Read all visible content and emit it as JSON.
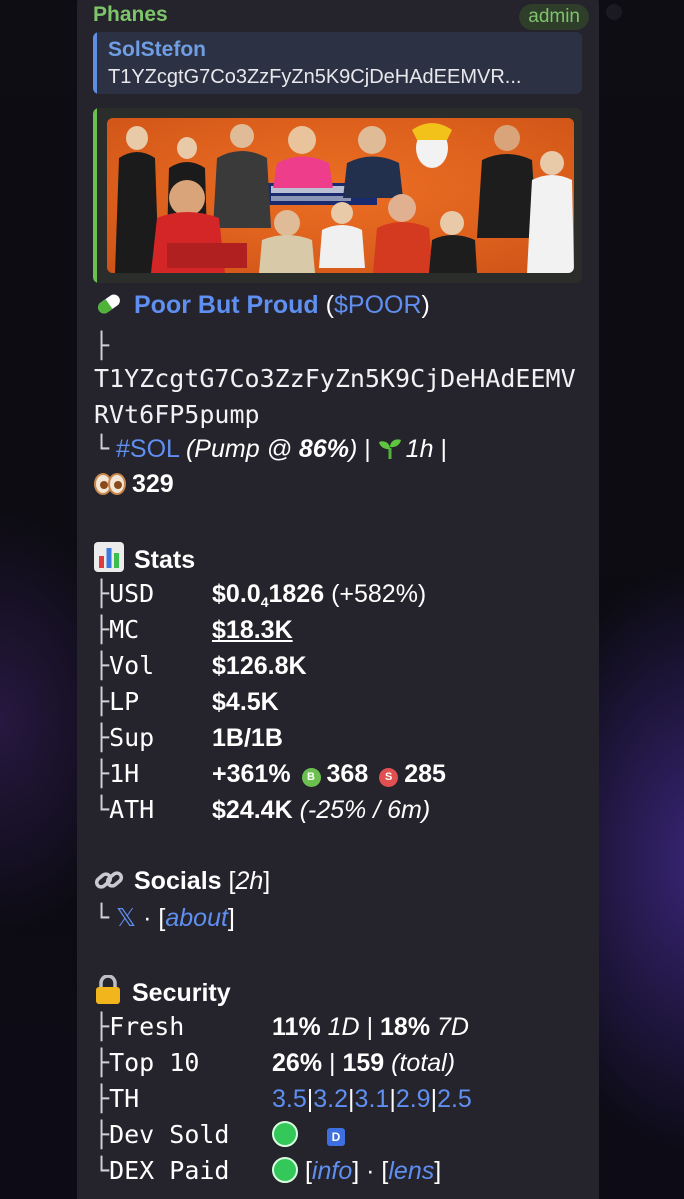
{
  "message": {
    "sender": "Phanes",
    "badge": "admin",
    "reply": {
      "name": "SolStefon",
      "text": "T1YZcgtG7Co3ZzFyZn5K9CjDeHAdEEMVR..."
    }
  },
  "token": {
    "name": "Poor But Proud",
    "paren_open": "(",
    "ticker": "$POOR",
    "paren_close": ")",
    "tree_branch": "├",
    "tree_end": "└",
    "address_line1": "T1YZcgtG7Co3ZzFyZn5K9CjDeHAdEEMV",
    "address_line2": "RVt6FP5pump",
    "chain": "#SOL",
    "pump_prefix": "(Pump @ ",
    "pump_pct": "86%",
    "pump_suffix": ")",
    "sep": "|",
    "age": "1h",
    "views": "329"
  },
  "stats": {
    "title": "Stats",
    "rows": {
      "usd": {
        "branch": "├",
        "label": "USD",
        "price_a": "$0.0",
        "price_sub": "4",
        "price_b": "1826",
        "change": "(+582%)"
      },
      "mc": {
        "branch": "├",
        "label": "MC",
        "value": "$18.3K"
      },
      "vol": {
        "branch": "├",
        "label": "Vol",
        "value": "$126.8K"
      },
      "lp": {
        "branch": "├",
        "label": "LP",
        "value": "$4.5K"
      },
      "sup": {
        "branch": "├",
        "label": "Sup",
        "value": "1B/1B"
      },
      "h1": {
        "branch": "├",
        "label": "1H",
        "value": "+361%",
        "buy_badge": "B",
        "buys": "368",
        "sell_badge": "S",
        "sells": "285"
      },
      "ath": {
        "branch": "└",
        "label": "ATH",
        "value": "$24.4K",
        "detail": "(-25% / 6m)"
      }
    }
  },
  "socials": {
    "title": "Socials",
    "age_open": "[",
    "age": "2h",
    "age_close": "]",
    "branch": "└",
    "x_icon": "𝕏",
    "dot": "·",
    "about_open": "[",
    "about": "about",
    "about_close": "]"
  },
  "security": {
    "title": "Security",
    "rows": {
      "fresh": {
        "branch": "├",
        "label": "Fresh",
        "v1": "11%",
        "p1": "1D",
        "sep": "|",
        "v2": "18%",
        "p2": "7D"
      },
      "top10": {
        "branch": "├",
        "label": "Top 10",
        "v1": "26%",
        "sep": "|",
        "v2": "159",
        "note": "(total)"
      },
      "th": {
        "branch": "├",
        "label": "TH",
        "values": [
          "3.5",
          "3.2",
          "3.1",
          "2.9",
          "2.5"
        ],
        "sep": "|"
      },
      "dev": {
        "branch": "├",
        "label": "Dev Sold",
        "badge": "D"
      },
      "dex": {
        "branch": "└",
        "label": "DEX Paid",
        "info_open": "[",
        "info": "info",
        "info_close": "]",
        "dot": "·",
        "lens_open": "[",
        "lens": "lens",
        "lens_close": "]"
      }
    }
  },
  "icons": {
    "pill": "pill-icon",
    "views": "eyes-icon",
    "seedling": "seedling-icon",
    "stats": "bar-chart-icon",
    "socials": "link-icon",
    "security": "lock-icon",
    "x": "x-logo-icon"
  },
  "colors": {
    "link": "#5f8ff0",
    "sender": "#7ec46a",
    "reply_accent": "#5d8ee0",
    "preview_accent": "#6cc04f",
    "check_green": "#34c759",
    "buy": "#6cc04f",
    "sell": "#e05050"
  }
}
